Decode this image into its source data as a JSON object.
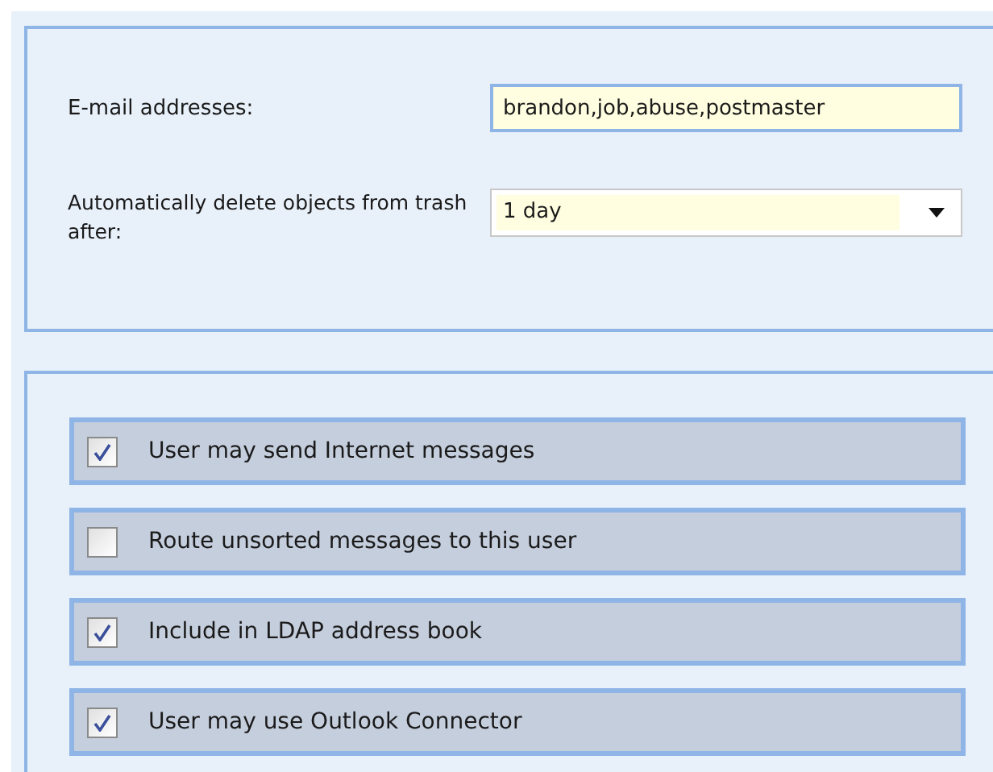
{
  "general": {
    "email_label": "E-mail addresses:",
    "email_value": "brandon,job,abuse,postmaster",
    "trash_label": "Automatically delete objects from trash after:",
    "trash_value": "1 day"
  },
  "options": [
    {
      "label": "User may send Internet messages",
      "checked": true
    },
    {
      "label": "Route unsorted messages to this user",
      "checked": false
    },
    {
      "label": "Include in LDAP address book",
      "checked": true
    },
    {
      "label": "User may use Outlook Connector",
      "checked": true
    }
  ]
}
